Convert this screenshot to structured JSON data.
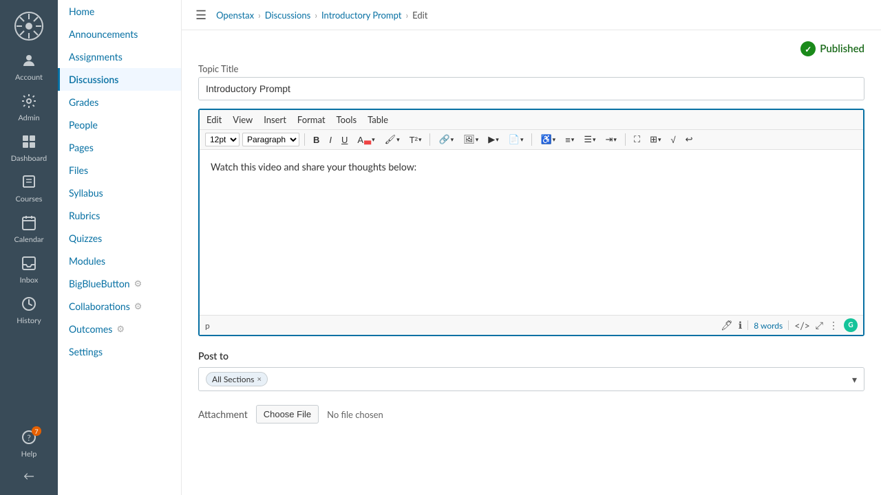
{
  "sidebar": {
    "logo_alt": "Openstax Logo",
    "items": [
      {
        "id": "account",
        "label": "Account",
        "icon": "👤"
      },
      {
        "id": "admin",
        "label": "Admin",
        "icon": "🔧"
      },
      {
        "id": "dashboard",
        "label": "Dashboard",
        "icon": "📊"
      },
      {
        "id": "courses",
        "label": "Courses",
        "icon": "📚"
      },
      {
        "id": "calendar",
        "label": "Calendar",
        "icon": "📅"
      },
      {
        "id": "inbox",
        "label": "Inbox",
        "icon": "📥"
      },
      {
        "id": "history",
        "label": "History",
        "icon": "🕐"
      }
    ],
    "help": {
      "label": "Help",
      "badge": "7"
    },
    "collapse": "←"
  },
  "breadcrumb": {
    "menu_title": "Menu",
    "parts": [
      "Openstax",
      "Discussions",
      "Introductory Prompt",
      "Edit"
    ]
  },
  "nav": {
    "items": [
      {
        "id": "home",
        "label": "Home",
        "active": false
      },
      {
        "id": "announcements",
        "label": "Announcements",
        "active": false
      },
      {
        "id": "assignments",
        "label": "Assignments",
        "active": false
      },
      {
        "id": "discussions",
        "label": "Discussions",
        "active": true
      },
      {
        "id": "grades",
        "label": "Grades",
        "active": false
      },
      {
        "id": "people",
        "label": "People",
        "active": false
      },
      {
        "id": "pages",
        "label": "Pages",
        "active": false
      },
      {
        "id": "files",
        "label": "Files",
        "active": false
      },
      {
        "id": "syllabus",
        "label": "Syllabus",
        "active": false
      },
      {
        "id": "rubrics",
        "label": "Rubrics",
        "active": false
      },
      {
        "id": "quizzes",
        "label": "Quizzes",
        "active": false
      },
      {
        "id": "modules",
        "label": "Modules",
        "active": false
      },
      {
        "id": "bigbluebutton",
        "label": "BigBlueButton",
        "active": false,
        "has_icon": true
      },
      {
        "id": "collaborations",
        "label": "Collaborations",
        "active": false,
        "has_icon": true
      },
      {
        "id": "outcomes",
        "label": "Outcomes",
        "active": false,
        "has_icon": true
      },
      {
        "id": "settings",
        "label": "Settings",
        "active": false
      }
    ]
  },
  "editor": {
    "status": "Published",
    "topic_title_label": "Topic Title",
    "topic_title_value": "Introductory Prompt",
    "menu_items": [
      "Edit",
      "View",
      "Insert",
      "Format",
      "Tools",
      "Table"
    ],
    "toolbar": {
      "font_size": "12pt",
      "paragraph": "Paragraph",
      "bold": "B",
      "italic": "I",
      "underline": "U"
    },
    "content": "Watch this video and share your thoughts below:",
    "footer": {
      "path": "p",
      "word_count": "8 words"
    },
    "post_to_label": "Post to",
    "post_to_value": "All Sections",
    "attachment_label": "Attachment",
    "choose_file_label": "Choose File",
    "no_file_text": "No file chosen"
  },
  "colors": {
    "published_green": "#1a8a1a",
    "link_blue": "#0770A3",
    "sidebar_bg": "#394B58"
  }
}
